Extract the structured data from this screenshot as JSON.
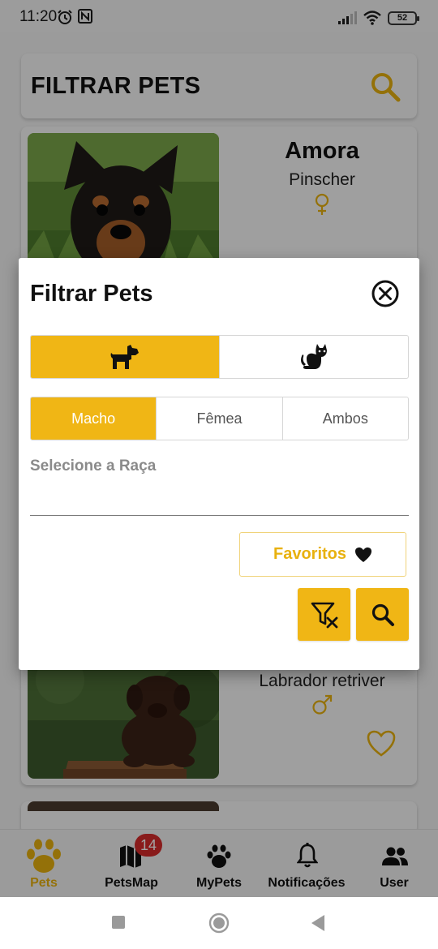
{
  "status_bar": {
    "time": "11:20",
    "battery": "52"
  },
  "header": {
    "title": "FILTRAR PETS"
  },
  "pets": [
    {
      "name": "Amora",
      "breed": "Pinscher",
      "sex": "female"
    },
    {
      "name": "",
      "breed": "Labrador retriver",
      "sex": "male"
    }
  ],
  "dialog": {
    "title": "Filtrar Pets",
    "species_options": [
      "dog",
      "cat"
    ],
    "species_selected": "dog",
    "sex_options": [
      "Macho",
      "Fêmea",
      "Ambos"
    ],
    "sex_selected": "Macho",
    "breed_label": "Selecione a Raça",
    "breed_value": "",
    "favorites_label": "Favoritos"
  },
  "bottom_nav": {
    "items": [
      {
        "label": "Pets",
        "icon": "paw-icon",
        "active": true
      },
      {
        "label": "PetsMap",
        "icon": "map-icon",
        "badge": "14"
      },
      {
        "label": "MyPets",
        "icon": "paw-outline-icon"
      },
      {
        "label": "Notificações",
        "icon": "bell-icon"
      },
      {
        "label": "User",
        "icon": "users-icon"
      }
    ]
  },
  "colors": {
    "accent": "#f0b615",
    "badge": "#d62b2b"
  }
}
